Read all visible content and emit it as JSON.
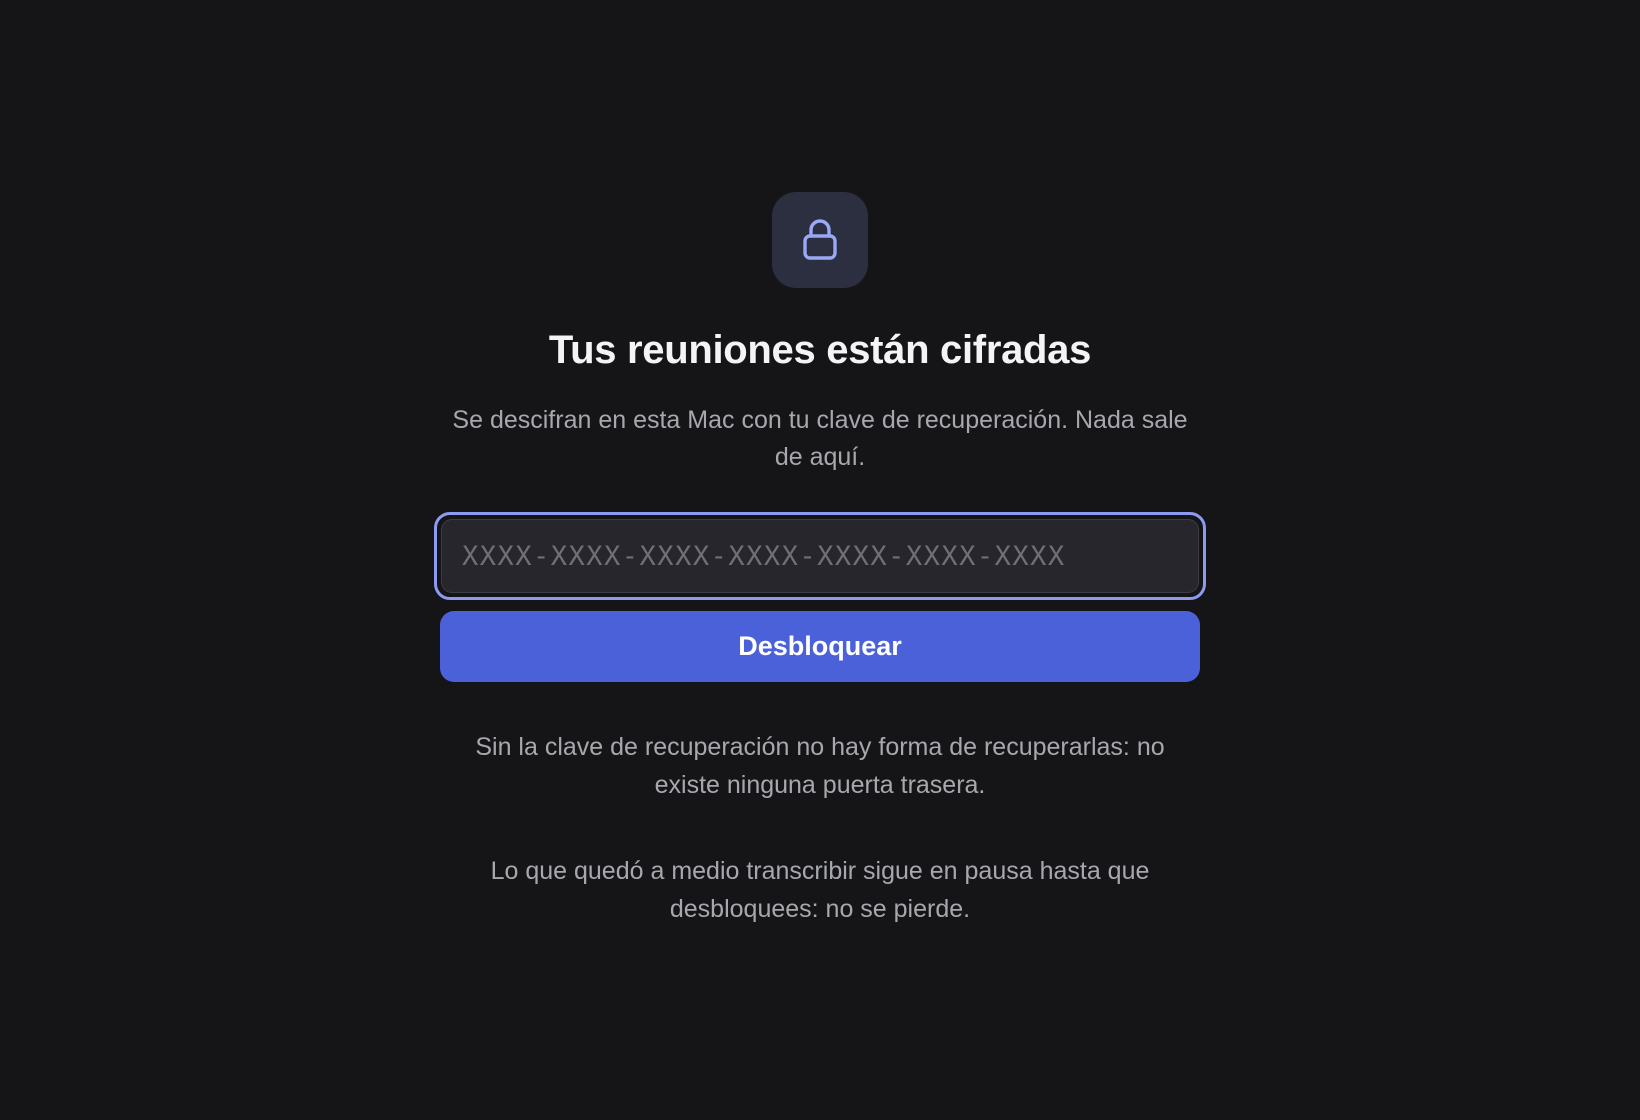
{
  "colors": {
    "background": "#151518",
    "lock_tile": "#2c2f40",
    "lock_icon": "#9aa8f5",
    "accent": "#4b61da",
    "focus_ring": "#8c9bf0",
    "title_text": "#f4f4f6",
    "body_text": "#a7a8ae"
  },
  "header": {
    "icon": "lock-icon",
    "title": "Tus reuniones están cifradas",
    "subtitle": "Se descifran en esta Mac con tu clave de recuperación. Nada sale de aquí."
  },
  "form": {
    "recovery_key": {
      "value": "",
      "placeholder": "XXXX-XXXX-XXXX-XXXX-XXXX-XXXX-XXXX"
    },
    "unlock_label": "Desbloquear"
  },
  "notes": {
    "no_backdoor": "Sin la clave de recuperación no hay forma de recuperarlas: no existe ninguna puerta trasera.",
    "paused_transcription": "Lo que quedó a medio transcribir sigue en pausa hasta que desbloquees: no se pierde."
  }
}
